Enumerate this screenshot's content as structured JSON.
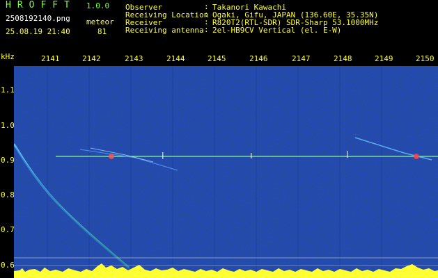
{
  "header": {
    "app_name": "HROFFT",
    "version": "1.0.0",
    "file_name": "2508192140.png",
    "meteor_label": "meteor",
    "datetime": "25.08.19 21:40",
    "meteor_count": "81"
  },
  "info": [
    {
      "label": "Observer",
      "value": "Takanori Kawachi"
    },
    {
      "label": "Receiving Location",
      "value": "Ogaki, Gifu, JAPAN (136.60E, 35.35N)"
    },
    {
      "label": "Receiver",
      "value": "R820T2(RTL-SDR) SDR-Sharp 53.1000MHz"
    },
    {
      "label": "Receiving antenna",
      "value": "2el-HB9CV Vertical (el. E-W)"
    }
  ],
  "axis": {
    "unit_label": "kHz",
    "time_labels": [
      "2141",
      "2142",
      "2143",
      "2144",
      "2145",
      "2146",
      "2147",
      "2148",
      "2149",
      "2150"
    ],
    "freq_labels": [
      "1.1",
      "1.0",
      "0.9",
      "0.8",
      "0.7",
      "0.6"
    ]
  },
  "colors": {
    "header_text": "#7CFF3A",
    "info_text": "#FFFF33",
    "background_noise": "#0A1F6E",
    "carrier_line": "#88FF88"
  }
}
